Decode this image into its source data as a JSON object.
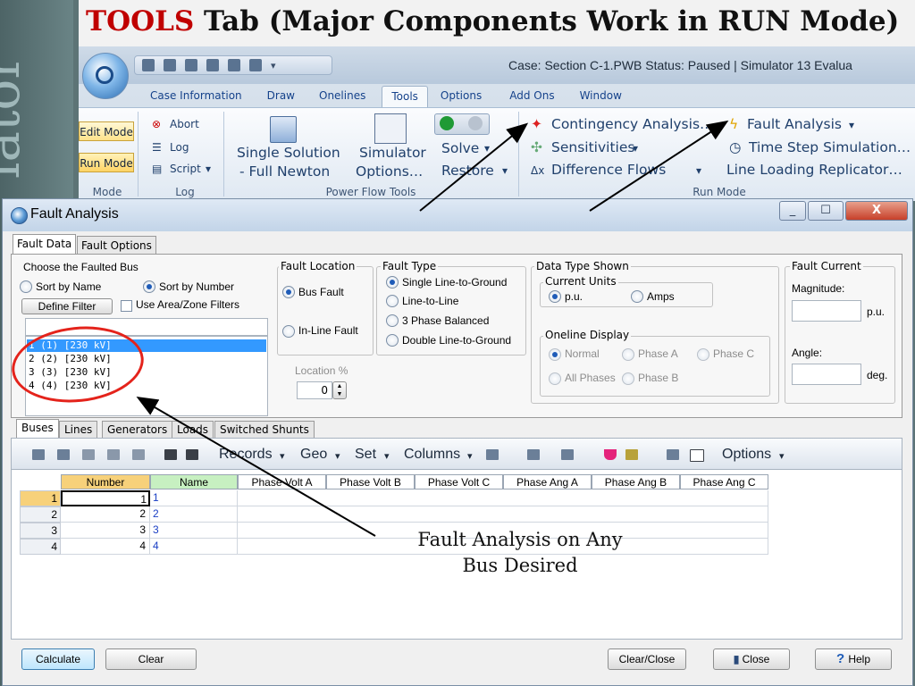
{
  "slide": {
    "title_red": "TOOLS",
    "title_rest": " Tab (Major Components Work in RUN Mode)",
    "side_text": "lator",
    "annotation_line1": "Fault Analysis on Any",
    "annotation_line2": "Bus Desired"
  },
  "app": {
    "case_title": "Case: Section C-1.PWB  Status: Paused | Simulator 13 Evalua",
    "tabs": [
      "Case Information",
      "Draw",
      "Onelines",
      "Tools",
      "Options",
      "Add Ons",
      "Window"
    ],
    "active_tab": "Tools"
  },
  "ribbon": {
    "mode": {
      "edit": "Edit Mode",
      "run": "Run Mode",
      "label": "Mode"
    },
    "log": {
      "abort": "Abort",
      "log": "Log",
      "script": "Script",
      "label": "Log"
    },
    "power_flow": {
      "single_solution_1": "Single Solution",
      "single_solution_2": "- Full Newton",
      "simulator_1": "Simulator",
      "simulator_2": "Options…",
      "solve": "Solve",
      "restore": "Restore",
      "label": "Power Flow Tools"
    },
    "run_mode": {
      "contingency": "Contingency Analysis…",
      "sensitivities": "Sensitivities",
      "difference_flows": "Difference Flows",
      "fault_analysis": "Fault Analysis",
      "time_step": "Time Step Simulation…",
      "line_loading": "Line Loading Replicator…",
      "label": "Run Mode"
    }
  },
  "dialog": {
    "title": "Fault Analysis",
    "tabs": [
      "Fault Data",
      "Fault Options"
    ],
    "choose_bus": "Choose the Faulted Bus",
    "sort_name": "Sort by Name",
    "sort_number": "Sort by Number",
    "define_filter": "Define Filter",
    "use_area_zone": "Use Area/Zone Filters",
    "bus_list": [
      "1 (1)  [230 kV]",
      "2 (2)  [230 kV]",
      "3 (3)  [230 kV]",
      "4 (4)  [230 kV]"
    ],
    "fault_location": {
      "title": "Fault Location",
      "bus_fault": "Bus Fault",
      "in_line_fault": "In-Line Fault",
      "location_pct": "Location %",
      "location_value": "0"
    },
    "fault_type": {
      "title": "Fault Type",
      "options": [
        "Single Line-to-Ground",
        "Line-to-Line",
        "3 Phase Balanced",
        "Double Line-to-Ground"
      ]
    },
    "data_type": {
      "title": "Data Type Shown",
      "current_units": "Current Units",
      "pu": "p.u.",
      "amps": "Amps",
      "oneline_display": "Oneline Display",
      "normal": "Normal",
      "phase_a": "Phase A",
      "phase_c": "Phase C",
      "all_phases": "All Phases",
      "phase_b": "Phase B"
    },
    "fault_current": {
      "title": "Fault Current",
      "magnitude": "Magnitude:",
      "magnitude_unit": "p.u.",
      "angle": "Angle:",
      "angle_unit": "deg."
    },
    "sub_tabs": [
      "Buses",
      "Lines",
      "Generators",
      "Loads",
      "Switched Shunts"
    ],
    "toolbar": [
      "Records",
      "Geo",
      "Set",
      "Columns",
      "Options"
    ],
    "grid": {
      "columns": [
        "Number",
        "Name",
        "Phase Volt A",
        "Phase Volt B",
        "Phase Volt C",
        "Phase Ang A",
        "Phase Ang B",
        "Phase Ang C"
      ],
      "rows": [
        {
          "row": "1",
          "number": "1",
          "name": "1"
        },
        {
          "row": "2",
          "number": "2",
          "name": "2"
        },
        {
          "row": "3",
          "number": "3",
          "name": "3"
        },
        {
          "row": "4",
          "number": "4",
          "name": "4"
        }
      ]
    },
    "buttons": {
      "calculate": "Calculate",
      "clear": "Clear",
      "clear_close": "Clear/Close",
      "close": "Close",
      "help": "Help"
    }
  }
}
